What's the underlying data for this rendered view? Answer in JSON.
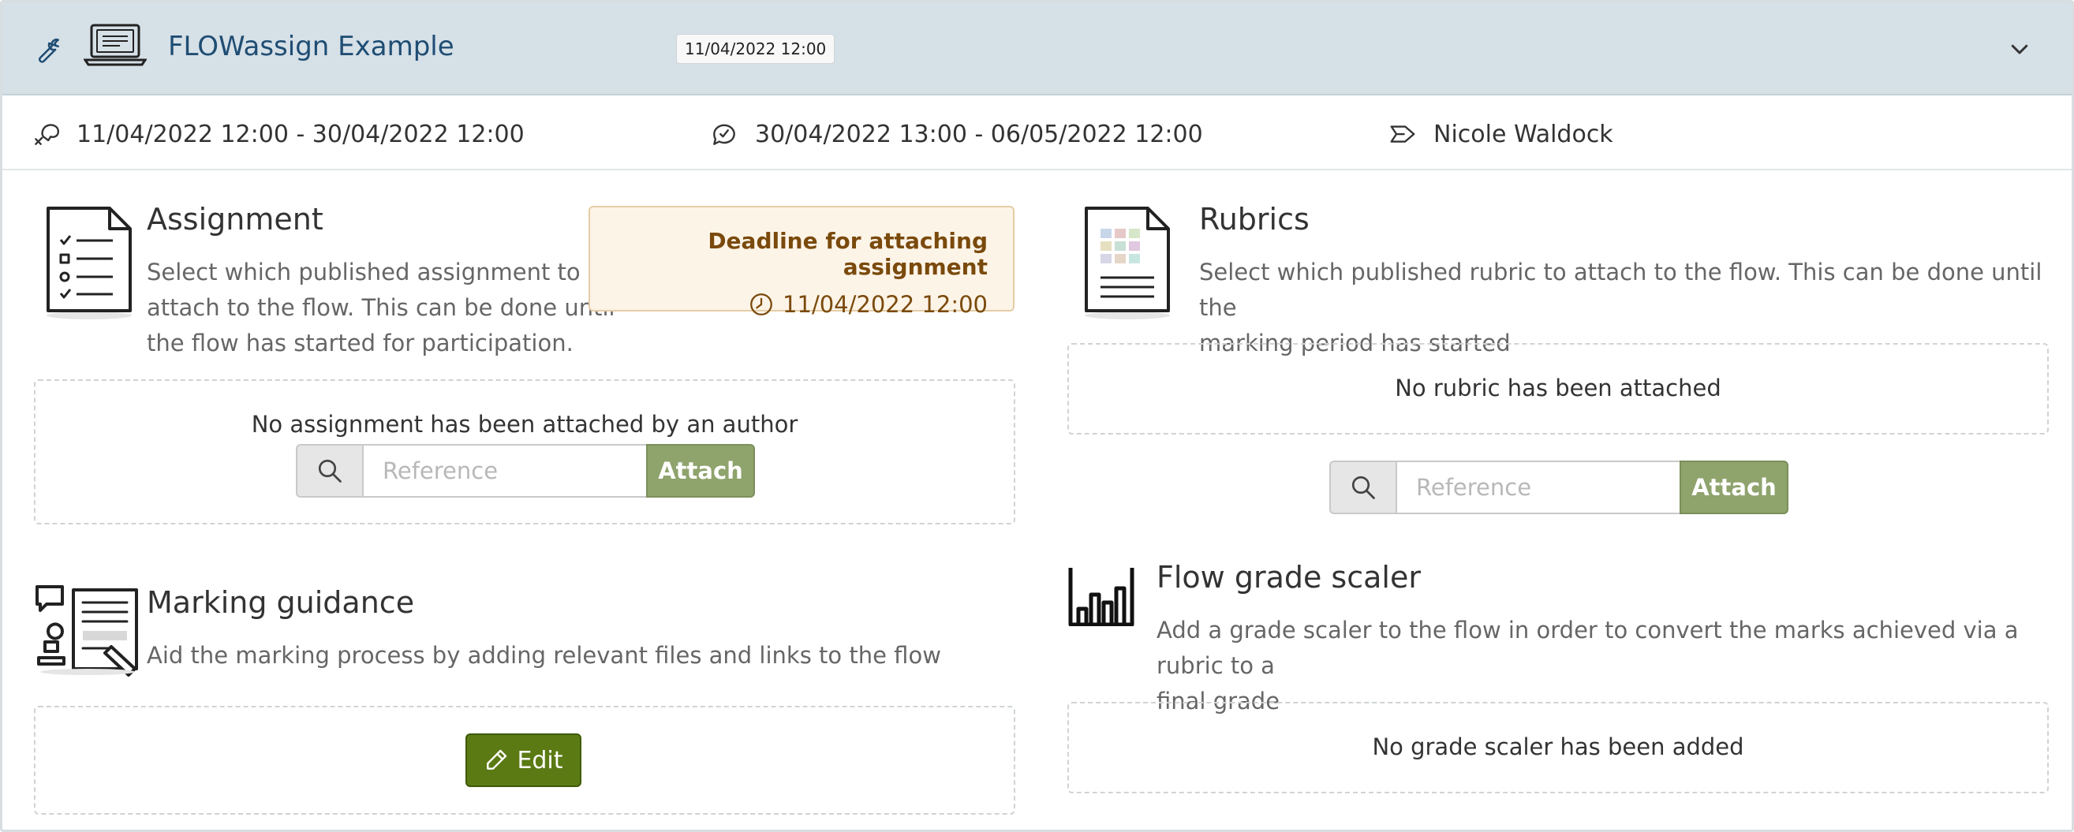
{
  "header": {
    "title": "FLOWassign Example",
    "date_badge": "11/04/2022 12:00"
  },
  "info": {
    "participation_period": "11/04/2022 12:00 - 30/04/2022 12:00",
    "marking_period": "30/04/2022 13:00 - 06/05/2022 12:00",
    "author": "Nicole Waldock"
  },
  "assignment": {
    "title": "Assignment",
    "description_lines": [
      "Select which published assignment to",
      "attach to the flow. This can be done until",
      "the flow has started for participation."
    ],
    "deadline_title": "Deadline for attaching assignment",
    "deadline_date": "11/04/2022 12:00",
    "empty_text": "No assignment has been attached by an author",
    "reference_placeholder": "Reference",
    "attach_label": "Attach"
  },
  "rubrics": {
    "title": "Rubrics",
    "description_lines": [
      "Select which published rubric to attach to the flow. This can be done until the",
      "marking period has started"
    ],
    "empty_text": "No rubric has been attached",
    "reference_placeholder": "Reference",
    "attach_label": "Attach"
  },
  "marking_guidance": {
    "title": "Marking guidance",
    "description": "Aid the marking process by adding relevant files and links to the flow",
    "edit_label": "Edit"
  },
  "grade_scaler": {
    "title": "Flow grade scaler",
    "description_lines": [
      "Add a grade scaler to the flow in order to convert the marks achieved via a rubric to a",
      "final grade"
    ],
    "empty_text": "No grade scaler has been added"
  },
  "colors": {
    "header_bg": "#d6e0e7",
    "title_blue": "#1f4d73",
    "attach_green": "#8fa36d",
    "edit_green": "#5b7a14",
    "deadline_bg": "#fdf4e8",
    "deadline_text": "#7a4a0c"
  }
}
